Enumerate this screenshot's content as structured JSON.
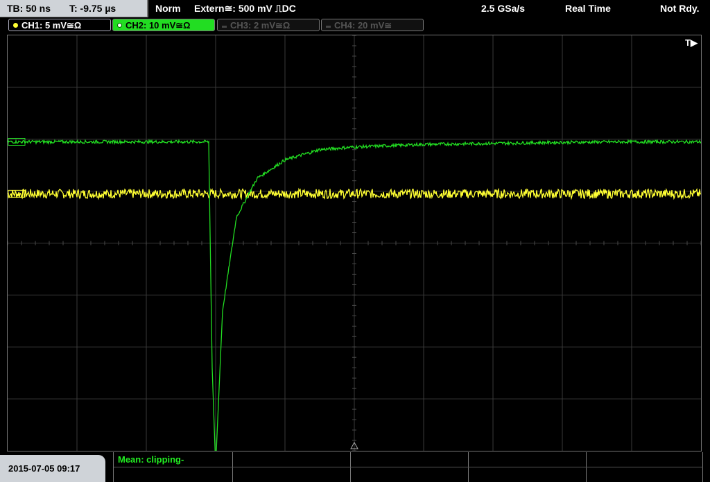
{
  "status": {
    "timebase": "TB: 50 ns",
    "trigger_time": "T: -9.75 µs",
    "mode": "Norm",
    "trigger_source": "Extern≅: 500 mV ⎍DC",
    "sample_rate": "2.5 GSa/s",
    "acq_mode": "Real Time",
    "state": "Not Rdy."
  },
  "channels": [
    {
      "label": "CH1: 5 mV≅Ω",
      "color": "#ffff33",
      "active": true
    },
    {
      "label": "CH2: 10 mV≅Ω",
      "color": "#22dd22",
      "active": true
    },
    {
      "label": "CH3: 2 mV≅Ω",
      "color": "#555555",
      "active": false
    },
    {
      "label": "CH4: 20 mV≅",
      "color": "#555555",
      "active": false
    }
  ],
  "trigger_marker": "T▶",
  "date": "2015-07-05 09:17",
  "measurement": {
    "text": "Mean: clipping-"
  },
  "chart_data": {
    "type": "line",
    "title": "",
    "x_divisions": 10,
    "y_divisions": 8,
    "series": [
      {
        "name": "CH1",
        "color": "#ffff33",
        "x": [
          0,
          1,
          2,
          3,
          4,
          5,
          6,
          7,
          8,
          9,
          10
        ],
        "y": [
          0.95,
          0.95,
          0.95,
          0.95,
          0.95,
          0.95,
          0.95,
          0.95,
          0.95,
          0.95,
          0.95
        ]
      },
      {
        "name": "CH2",
        "color": "#22dd22",
        "x": [
          0,
          2.9,
          2.95,
          3.0,
          3.1,
          3.3,
          3.6,
          4.0,
          4.5,
          5.0,
          6.0,
          7.0,
          8.0,
          9.0,
          10.0
        ],
        "y": [
          1.95,
          1.95,
          -2.4,
          -4.3,
          -1.3,
          0.5,
          1.25,
          1.6,
          1.8,
          1.85,
          1.9,
          1.92,
          1.94,
          1.95,
          1.95
        ]
      }
    ]
  }
}
